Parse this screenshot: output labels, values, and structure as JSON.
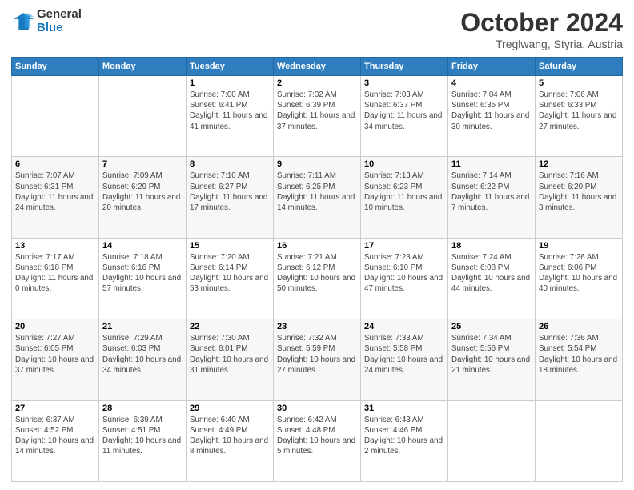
{
  "logo": {
    "general": "General",
    "blue": "Blue"
  },
  "header": {
    "month": "October 2024",
    "location": "Treglwang, Styria, Austria"
  },
  "days_of_week": [
    "Sunday",
    "Monday",
    "Tuesday",
    "Wednesday",
    "Thursday",
    "Friday",
    "Saturday"
  ],
  "weeks": [
    [
      {
        "num": "",
        "info": ""
      },
      {
        "num": "",
        "info": ""
      },
      {
        "num": "1",
        "info": "Sunrise: 7:00 AM\nSunset: 6:41 PM\nDaylight: 11 hours and 41 minutes."
      },
      {
        "num": "2",
        "info": "Sunrise: 7:02 AM\nSunset: 6:39 PM\nDaylight: 11 hours and 37 minutes."
      },
      {
        "num": "3",
        "info": "Sunrise: 7:03 AM\nSunset: 6:37 PM\nDaylight: 11 hours and 34 minutes."
      },
      {
        "num": "4",
        "info": "Sunrise: 7:04 AM\nSunset: 6:35 PM\nDaylight: 11 hours and 30 minutes."
      },
      {
        "num": "5",
        "info": "Sunrise: 7:06 AM\nSunset: 6:33 PM\nDaylight: 11 hours and 27 minutes."
      }
    ],
    [
      {
        "num": "6",
        "info": "Sunrise: 7:07 AM\nSunset: 6:31 PM\nDaylight: 11 hours and 24 minutes."
      },
      {
        "num": "7",
        "info": "Sunrise: 7:09 AM\nSunset: 6:29 PM\nDaylight: 11 hours and 20 minutes."
      },
      {
        "num": "8",
        "info": "Sunrise: 7:10 AM\nSunset: 6:27 PM\nDaylight: 11 hours and 17 minutes."
      },
      {
        "num": "9",
        "info": "Sunrise: 7:11 AM\nSunset: 6:25 PM\nDaylight: 11 hours and 14 minutes."
      },
      {
        "num": "10",
        "info": "Sunrise: 7:13 AM\nSunset: 6:23 PM\nDaylight: 11 hours and 10 minutes."
      },
      {
        "num": "11",
        "info": "Sunrise: 7:14 AM\nSunset: 6:22 PM\nDaylight: 11 hours and 7 minutes."
      },
      {
        "num": "12",
        "info": "Sunrise: 7:16 AM\nSunset: 6:20 PM\nDaylight: 11 hours and 3 minutes."
      }
    ],
    [
      {
        "num": "13",
        "info": "Sunrise: 7:17 AM\nSunset: 6:18 PM\nDaylight: 11 hours and 0 minutes."
      },
      {
        "num": "14",
        "info": "Sunrise: 7:18 AM\nSunset: 6:16 PM\nDaylight: 10 hours and 57 minutes."
      },
      {
        "num": "15",
        "info": "Sunrise: 7:20 AM\nSunset: 6:14 PM\nDaylight: 10 hours and 53 minutes."
      },
      {
        "num": "16",
        "info": "Sunrise: 7:21 AM\nSunset: 6:12 PM\nDaylight: 10 hours and 50 minutes."
      },
      {
        "num": "17",
        "info": "Sunrise: 7:23 AM\nSunset: 6:10 PM\nDaylight: 10 hours and 47 minutes."
      },
      {
        "num": "18",
        "info": "Sunrise: 7:24 AM\nSunset: 6:08 PM\nDaylight: 10 hours and 44 minutes."
      },
      {
        "num": "19",
        "info": "Sunrise: 7:26 AM\nSunset: 6:06 PM\nDaylight: 10 hours and 40 minutes."
      }
    ],
    [
      {
        "num": "20",
        "info": "Sunrise: 7:27 AM\nSunset: 6:05 PM\nDaylight: 10 hours and 37 minutes."
      },
      {
        "num": "21",
        "info": "Sunrise: 7:29 AM\nSunset: 6:03 PM\nDaylight: 10 hours and 34 minutes."
      },
      {
        "num": "22",
        "info": "Sunrise: 7:30 AM\nSunset: 6:01 PM\nDaylight: 10 hours and 31 minutes."
      },
      {
        "num": "23",
        "info": "Sunrise: 7:32 AM\nSunset: 5:59 PM\nDaylight: 10 hours and 27 minutes."
      },
      {
        "num": "24",
        "info": "Sunrise: 7:33 AM\nSunset: 5:58 PM\nDaylight: 10 hours and 24 minutes."
      },
      {
        "num": "25",
        "info": "Sunrise: 7:34 AM\nSunset: 5:56 PM\nDaylight: 10 hours and 21 minutes."
      },
      {
        "num": "26",
        "info": "Sunrise: 7:36 AM\nSunset: 5:54 PM\nDaylight: 10 hours and 18 minutes."
      }
    ],
    [
      {
        "num": "27",
        "info": "Sunrise: 6:37 AM\nSunset: 4:52 PM\nDaylight: 10 hours and 14 minutes."
      },
      {
        "num": "28",
        "info": "Sunrise: 6:39 AM\nSunset: 4:51 PM\nDaylight: 10 hours and 11 minutes."
      },
      {
        "num": "29",
        "info": "Sunrise: 6:40 AM\nSunset: 4:49 PM\nDaylight: 10 hours and 8 minutes."
      },
      {
        "num": "30",
        "info": "Sunrise: 6:42 AM\nSunset: 4:48 PM\nDaylight: 10 hours and 5 minutes."
      },
      {
        "num": "31",
        "info": "Sunrise: 6:43 AM\nSunset: 4:46 PM\nDaylight: 10 hours and 2 minutes."
      },
      {
        "num": "",
        "info": ""
      },
      {
        "num": "",
        "info": ""
      }
    ]
  ]
}
